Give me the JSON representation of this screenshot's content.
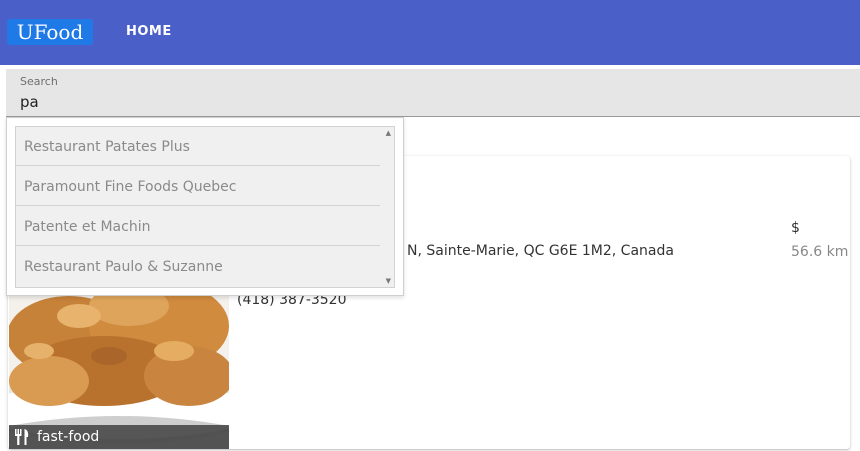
{
  "header": {
    "logo": "UFood",
    "nav": {
      "home": "HOME"
    }
  },
  "search": {
    "label": "Search",
    "value": "pa"
  },
  "suggestions": [
    "Restaurant Patates Plus",
    "Paramount Fine Foods Quebec",
    "Patente et Machin",
    "Restaurant Paulo & Suzanne"
  ],
  "restaurant": {
    "address_visible": "N, Sainte-Marie, QC G6E 1M2, Canada",
    "phone": "(418) 387-3520",
    "price": "$",
    "distance": "56.6 km",
    "tag": "fast-food",
    "tag_icon": "utensils-icon"
  },
  "colors": {
    "topbar": "#4a5fc8",
    "logo_bg": "#1f7ae8",
    "search_bg": "#e6e6e6",
    "suggestion_text": "#8a8a8a"
  }
}
